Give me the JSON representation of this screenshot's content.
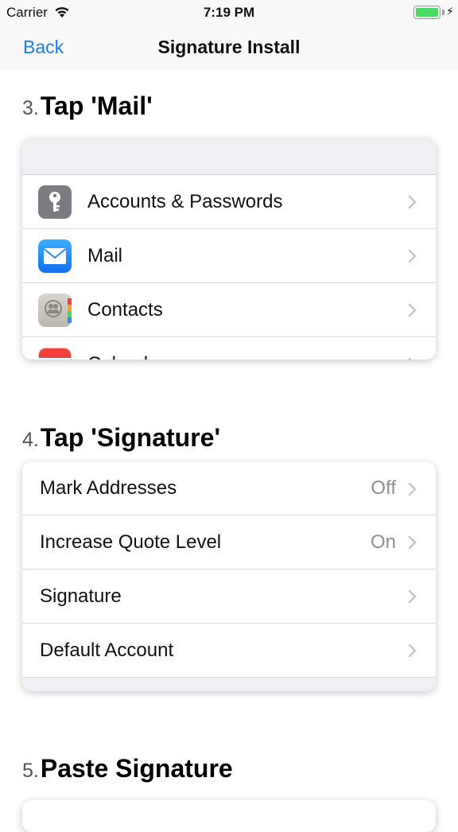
{
  "status_bar": {
    "carrier": "Carrier",
    "time": "7:19 PM",
    "battery_level": 1.0,
    "charging": true,
    "battery_color": "#4cd964"
  },
  "nav": {
    "back_label": "Back",
    "title": "Signature Install",
    "accent_color": "#1a7cf5"
  },
  "steps": [
    {
      "number": "3.",
      "title": "Tap 'Mail'",
      "rows": [
        {
          "label": "Accounts & Passwords",
          "icon": "key-icon"
        },
        {
          "label": "Mail",
          "icon": "mail-icon"
        },
        {
          "label": "Contacts",
          "icon": "contacts-icon"
        },
        {
          "label": "Calendar",
          "icon": "calendar-icon"
        }
      ]
    },
    {
      "number": "4.",
      "title": "Tap 'Signature'",
      "rows": [
        {
          "label": "Mark Addresses",
          "value": "Off"
        },
        {
          "label": "Increase Quote Level",
          "value": "On"
        },
        {
          "label": "Signature",
          "value": ""
        },
        {
          "label": "Default Account",
          "value": ""
        }
      ]
    },
    {
      "number": "5.",
      "title": "Paste Signature"
    }
  ]
}
